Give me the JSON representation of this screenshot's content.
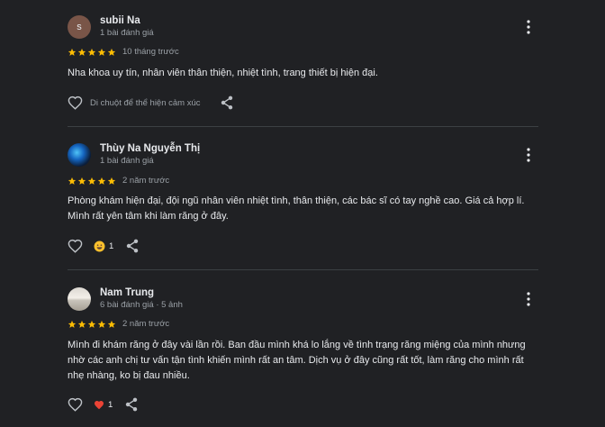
{
  "reviews": [
    {
      "avatar_letter": "s",
      "name": "subii Na",
      "meta": "1 bài đánh giá",
      "rating": 5,
      "time": "10 tháng trước",
      "text": "Nha khoa uy tín, nhân viên thân thiện, nhiệt tình, trang thiết bị hiện đại.",
      "reaction_hint": "Di chuột để thể hiện cảm xúc"
    },
    {
      "name": "Thùy Na Nguyễn Thị",
      "meta": "1 bài đánh giá",
      "rating": 5,
      "time": "2 năm trước",
      "text": "Phòng khám hiện đại, đội ngũ nhân viên nhiệt tình, thân thiện, các bác sĩ có tay nghề cao. Giá cả hợp lí. Mình rất yên tâm khi làm răng ở đây.",
      "reaction_icon": "grinning-emoji-icon",
      "reaction_count": "1"
    },
    {
      "name": "Nam Trung",
      "meta": "6 bài đánh giá · 5 ảnh",
      "rating": 5,
      "time": "2 năm trước",
      "text": "Mình đi khám răng ở đây vài lần rồi. Ban đầu mình khá lo lắng về tình trạng răng miệng của mình nhưng nhờ các anh chị tư vấn tận tình khiến mình rất an tâm. Dịch vụ ở đây cũng rất tốt, làm răng cho mình rất nhẹ nhàng, ko bị đau nhiều.",
      "reaction_icon": "red-heart-icon",
      "reaction_count": "1"
    }
  ],
  "colors": {
    "background": "#202124",
    "star": "#fbbc04",
    "muted_text": "#9aa0a6",
    "heart_reaction": "#ea4335"
  }
}
